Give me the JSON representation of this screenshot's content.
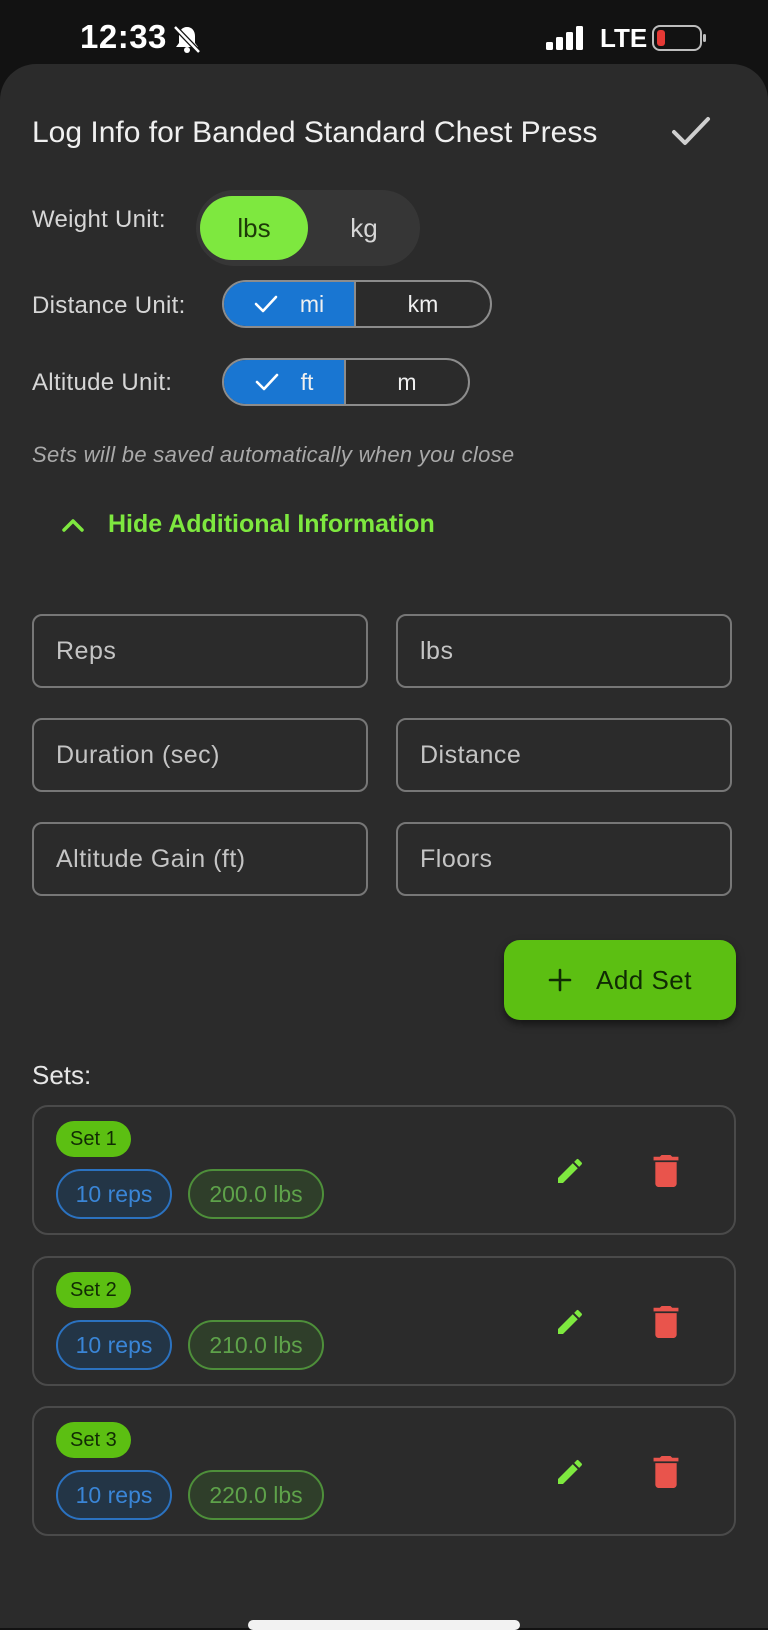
{
  "status_bar": {
    "time": "12:33",
    "network": "LTE"
  },
  "sheet": {
    "title": "Log Info for Banded Standard Chest Press",
    "weight_unit": {
      "label": "Weight Unit:",
      "options": [
        "lbs",
        "kg"
      ],
      "selected": "lbs"
    },
    "distance_unit": {
      "label": "Distance Unit:",
      "options": [
        "mi",
        "km"
      ],
      "selected": "mi"
    },
    "altitude_unit": {
      "label": "Altitude Unit:",
      "options": [
        "ft",
        "m"
      ],
      "selected": "ft"
    },
    "note": "Sets will be saved automatically when you close",
    "toggle_label": "Hide Additional Information",
    "fields": {
      "reps": "Reps",
      "weight": "lbs",
      "duration": "Duration (sec)",
      "distance": "Distance",
      "altitude": "Altitude Gain (ft)",
      "floors": "Floors"
    },
    "add_set_label": "Add Set",
    "sets_label": "Sets:",
    "sets": [
      {
        "name": "Set 1",
        "reps": "10 reps",
        "weight": "200.0 lbs"
      },
      {
        "name": "Set 2",
        "reps": "10 reps",
        "weight": "210.0 lbs"
      },
      {
        "name": "Set 3",
        "reps": "10 reps",
        "weight": "220.0 lbs"
      }
    ]
  },
  "icons": {
    "confirm": "check-icon",
    "edit": "pencil-icon",
    "delete": "trash-icon",
    "add": "plus-icon",
    "toggle": "chevron-up-icon"
  },
  "colors": {
    "accent_green": "#7ee83f",
    "button_green": "#5cbf12",
    "selected_blue": "#1976d2",
    "delete_red": "#e9544c",
    "sheet_bg": "#2b2b2b"
  }
}
